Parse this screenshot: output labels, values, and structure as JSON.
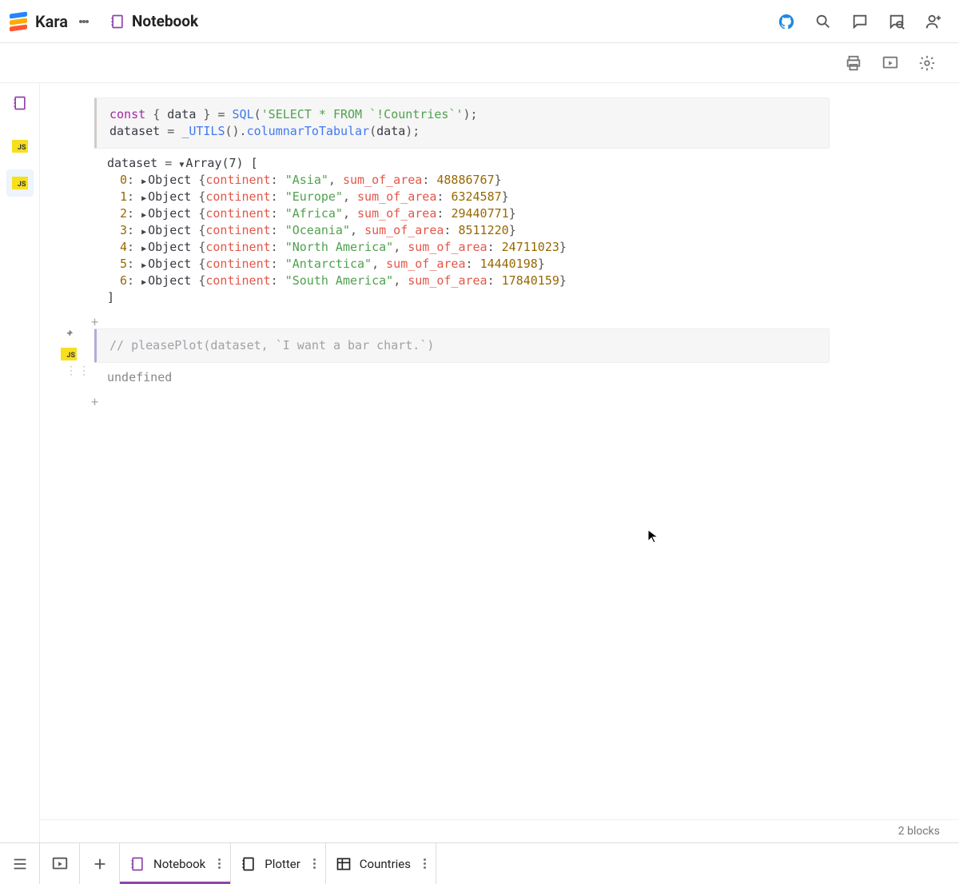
{
  "header": {
    "brand": "Kara",
    "title": "Notebook"
  },
  "gutter": {
    "cells": [
      {
        "lang": "JS"
      },
      {
        "lang": "JS"
      }
    ]
  },
  "cells": [
    {
      "lang": "JS",
      "code": {
        "kw_const": "const",
        "brace_l": "{",
        "var_data": "data",
        "brace_r": "}",
        "eq": "=",
        "fn_sql": "SQL",
        "sql_str": "'SELECT * FROM `!Countries`'",
        "line2_lhs": "dataset",
        "line2_eq": "=",
        "line2_utils": "_UTILS",
        "line2_method": "columnarToTabular",
        "line2_arg": "data"
      },
      "output": {
        "lhs": "dataset",
        "eq": "=",
        "array_label": "Array(7) [",
        "close": "]",
        "obj_word": "Object",
        "key1": "continent",
        "key2": "sum_of_area",
        "rows": [
          {
            "idx": "0",
            "continent": "\"Asia\"",
            "area": "48886767"
          },
          {
            "idx": "1",
            "continent": "\"Europe\"",
            "area": "6324587"
          },
          {
            "idx": "2",
            "continent": "\"Africa\"",
            "area": "29440771"
          },
          {
            "idx": "3",
            "continent": "\"Oceania\"",
            "area": "8511220"
          },
          {
            "idx": "4",
            "continent": "\"North America\"",
            "area": "24711023"
          },
          {
            "idx": "5",
            "continent": "\"Antarctica\"",
            "area": "14440198"
          },
          {
            "idx": "6",
            "continent": "\"South America\"",
            "area": "17840159"
          }
        ]
      }
    },
    {
      "lang": "JS",
      "focused": true,
      "code_comment": "// pleasePlot(dataset, `I want a bar chart.`)",
      "output_text": "undefined"
    }
  ],
  "status": {
    "blocks": "2 blocks"
  },
  "tabs": [
    {
      "label": "Notebook",
      "icon": "notebook",
      "active": true,
      "color": "#8e44ad"
    },
    {
      "label": "Plotter",
      "icon": "notebook",
      "active": false,
      "color": "#222"
    },
    {
      "label": "Countries",
      "icon": "table",
      "active": false,
      "color": "#222"
    }
  ],
  "icons": {
    "github": "github-icon",
    "search": "search-icon",
    "chat": "chat-icon",
    "chatsearch": "chat-search-icon",
    "user": "user-add-icon",
    "print": "print-icon",
    "present": "present-icon",
    "gear": "gear-icon"
  }
}
